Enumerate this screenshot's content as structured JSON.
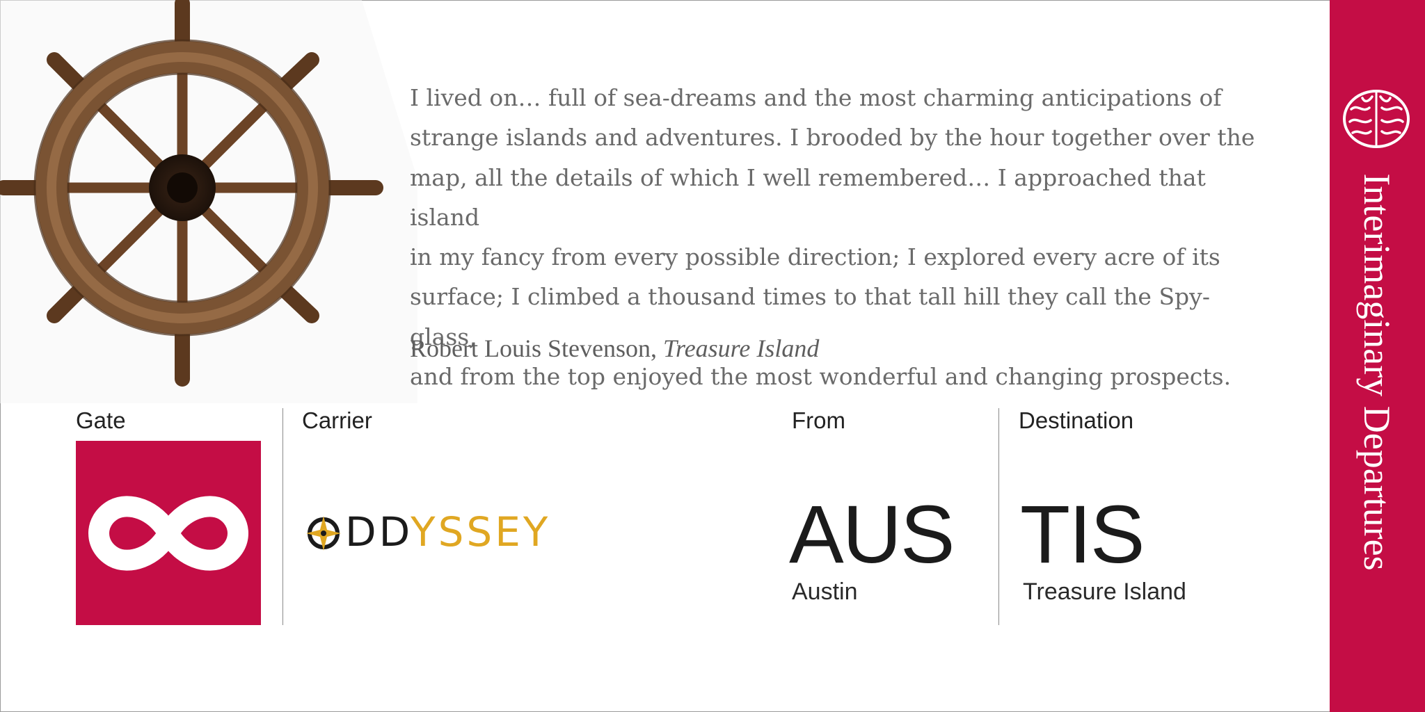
{
  "quote": {
    "lines": [
      "I lived on… full of sea-dreams and the most charming anticipations of",
      "strange islands and adventures. I brooded by the hour together over the",
      "map, all the details of which I well remembered… I approached that island",
      "in my fancy from every possible direction; I explored every acre of its",
      "surface; I climbed a thousand times to that tall hill they call the Spy-glass,",
      "and from the top enjoyed the most wonderful and changing prospects."
    ],
    "author": "Robert Louis Stevenson,",
    "work": "Treasure Island"
  },
  "gate": {
    "label": "Gate",
    "icon": "infinity-icon"
  },
  "carrier": {
    "label": "Carrier",
    "logo_text_dark": "DD",
    "logo_text_gold": "YSSEY",
    "logo_prefix": "O"
  },
  "from": {
    "label": "From",
    "code": "AUS",
    "city": "Austin"
  },
  "destination": {
    "label": "Destination",
    "code": "TIS",
    "city": "Treasure Island"
  },
  "sidebar": {
    "title": "Interimaginary Departures",
    "icon": "brain-icon"
  },
  "colors": {
    "accent": "#c40d45",
    "gold": "#e0a722",
    "wood": "#8a5a32"
  }
}
